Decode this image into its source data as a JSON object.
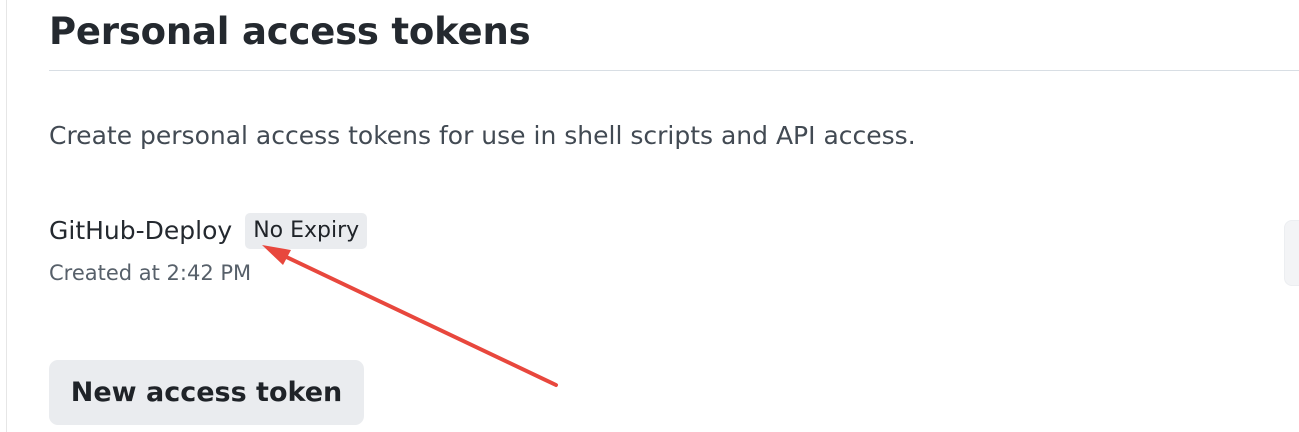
{
  "page": {
    "title": "Personal access tokens",
    "description": "Create personal access tokens for use in shell scripts and API access."
  },
  "tokens": [
    {
      "name": "GitHub-Deploy",
      "expiry_badge": "No Expiry",
      "created": "Created at 2:42 PM"
    }
  ],
  "actions": {
    "new_token_label": "New access token"
  },
  "annotation": {
    "arrow_color": "#e8473d"
  }
}
